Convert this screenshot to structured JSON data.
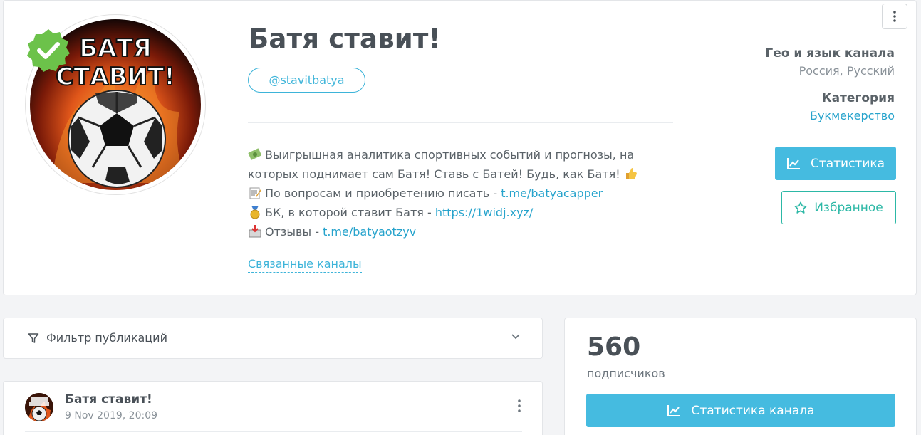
{
  "channel": {
    "title": "Батя ставит!",
    "handle": "@stavitbatya",
    "avatar_text": [
      "БАТЯ",
      "СТАВИТ!"
    ],
    "description": [
      {
        "emoji": "money-icon",
        "text": "Выигрышная аналитика спортивных событий и прогнозы, на"
      },
      {
        "text": "которых поднимает сам Батя! Ставь с Батей! Будь, как Батя!",
        "emoji_after": "thumbs-up-icon"
      },
      {
        "emoji": "memo-icon",
        "text": "По вопросам и приобретению писать - ",
        "link": "t.me/batyacapper"
      },
      {
        "emoji": "medal-icon",
        "text": "БК, в которой ставит Батя - ",
        "link": "https://1widj.xyz/"
      },
      {
        "emoji": "inbox-icon",
        "text": "Отзывы - ",
        "link": "t.me/batyaotzyv"
      }
    ],
    "related_label": "Связанные каналы",
    "geo_label": "Гео и язык канала",
    "geo_value": "Россия, Русский",
    "category_label": "Категория",
    "category_value": "Букмекерство",
    "stats_button": "Статистика",
    "favorite_button": "Избранное"
  },
  "filter": {
    "label": "Фильтр публикаций"
  },
  "post": {
    "title": "Батя ставит!",
    "date": "9 Nov 2019, 20:09"
  },
  "subscribers": {
    "count": "560",
    "label": "подписчиков",
    "stats_button": "Статистика канала"
  },
  "colors": {
    "accent": "#45bbe0",
    "link": "#26a3cc",
    "favorite": "#2cb8a6",
    "verified": "#6cc24a"
  }
}
